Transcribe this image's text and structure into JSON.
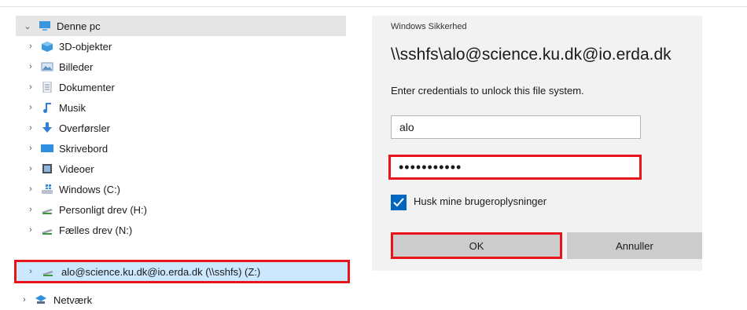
{
  "explorer": {
    "root": {
      "label": "Denne pc",
      "icon": "pc-icon"
    },
    "items": [
      {
        "label": "3D-objekter",
        "icon": "3d-objects-icon"
      },
      {
        "label": "Billeder",
        "icon": "pictures-icon"
      },
      {
        "label": "Dokumenter",
        "icon": "documents-icon"
      },
      {
        "label": "Musik",
        "icon": "music-icon"
      },
      {
        "label": "Overførsler",
        "icon": "downloads-icon"
      },
      {
        "label": "Skrivebord",
        "icon": "desktop-icon"
      },
      {
        "label": "Videoer",
        "icon": "videos-icon"
      },
      {
        "label": "Windows (C:)",
        "icon": "windows-drive-icon"
      },
      {
        "label": "Personligt drev (H:)",
        "icon": "network-drive-icon"
      },
      {
        "label": "Fælles drev (N:)",
        "icon": "network-drive-icon"
      },
      {
        "label": "alo@science.ku.dk@io.erda.dk (\\\\sshfs) (Z:)",
        "icon": "network-drive-icon"
      }
    ],
    "network": {
      "label": "Netværk",
      "icon": "network-icon"
    }
  },
  "dialog": {
    "caption": "Windows Sikkerhed",
    "title": "\\\\sshfs\\alo@science.ku.dk@io.erda.dk",
    "message": "Enter credentials to unlock this file system.",
    "username": "alo",
    "password_mask": "•••••••••••",
    "remember_label": "Husk mine brugeroplysninger",
    "remember_checked": true,
    "ok_label": "OK",
    "cancel_label": "Annuller"
  },
  "colors": {
    "highlight": "#e8141c",
    "accent": "#0067c0",
    "selection": "#cce8ff"
  }
}
